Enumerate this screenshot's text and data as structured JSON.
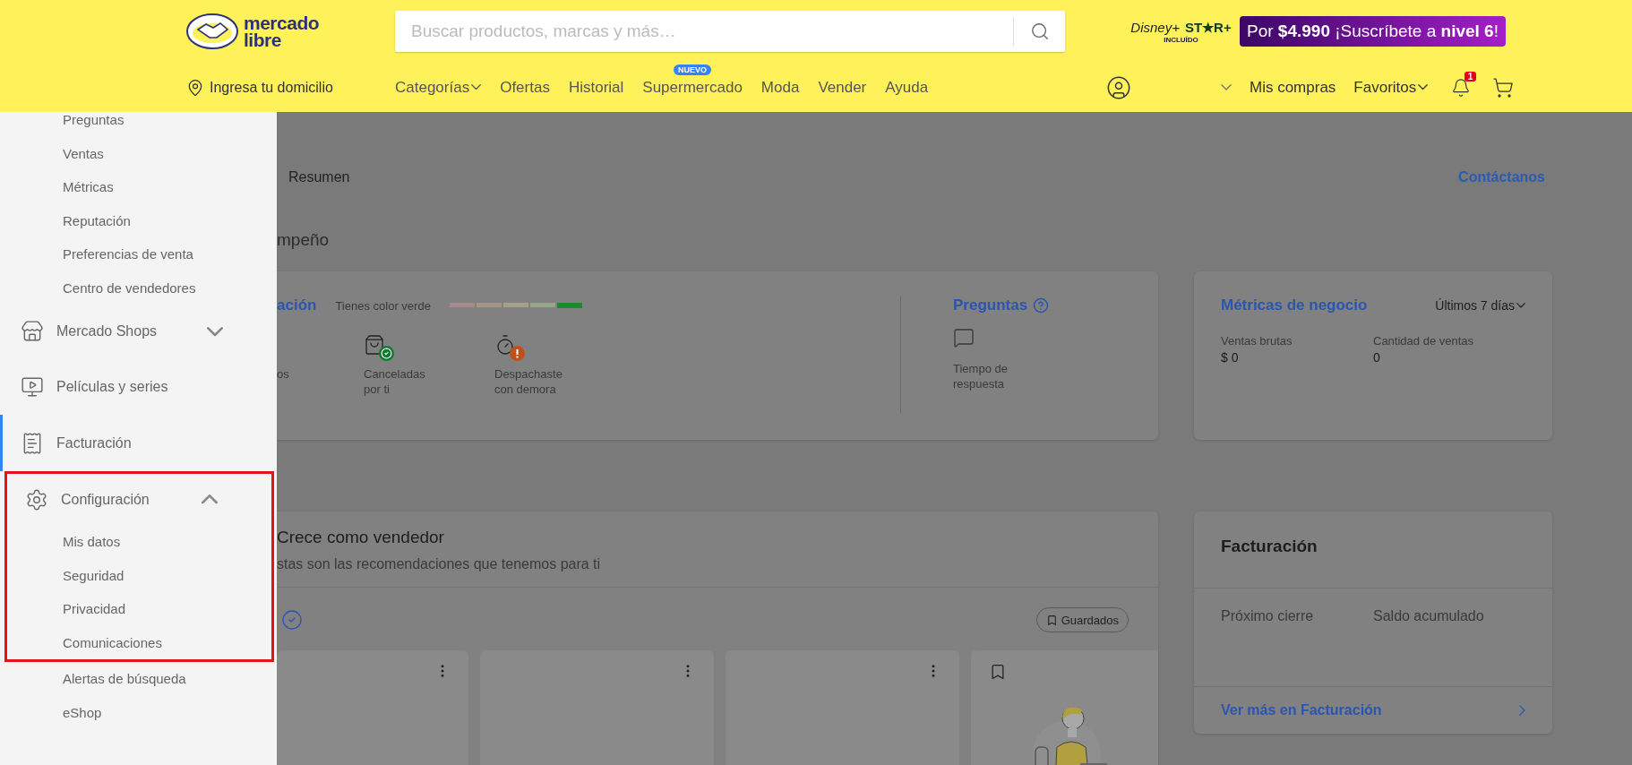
{
  "header": {
    "logo": {
      "line1": "mercado",
      "line2": "libre"
    },
    "search": {
      "placeholder": "Buscar productos, marcas y más…"
    },
    "streaming": {
      "brand1": "Disney+",
      "brand2": "ST★R+",
      "note": "INCLUÍDO"
    },
    "promo": "Por **$4.990** ¡Suscríbete a **nivel 6**!",
    "location": "Ingresa tu domicilio",
    "nav": [
      {
        "label": "Categorías",
        "dropdown": true
      },
      {
        "label": "Ofertas",
        "dropdown": false
      },
      {
        "label": "Historial",
        "dropdown": false
      },
      {
        "label": "Supermercado",
        "dropdown": false,
        "badge": "NUEVO"
      },
      {
        "label": "Moda",
        "dropdown": false
      },
      {
        "label": "Vender",
        "dropdown": false
      },
      {
        "label": "Ayuda",
        "dropdown": false
      }
    ],
    "account": {
      "dropdown": true
    },
    "links": [
      {
        "label": "Mis compras",
        "dropdown": false
      },
      {
        "label": "Favoritos",
        "dropdown": true
      }
    ],
    "notifications": "1"
  },
  "sidebar": {
    "items": [
      {
        "kind": "link",
        "label": "Preguntas"
      },
      {
        "kind": "link",
        "label": "Ventas"
      },
      {
        "kind": "link",
        "label": "Métricas"
      },
      {
        "kind": "link",
        "label": "Reputación"
      },
      {
        "kind": "link",
        "label": "Preferencias de venta"
      },
      {
        "kind": "link",
        "label": "Centro de vendedores"
      },
      {
        "kind": "section",
        "label": "Mercado Shops",
        "expanded": false,
        "selected": false
      },
      {
        "kind": "section",
        "label": "Películas y series",
        "selected": false
      },
      {
        "kind": "section",
        "label": "Facturación",
        "selected": true
      },
      {
        "kind": "section",
        "label": "Configuración",
        "expanded": true,
        "selected": false,
        "highlighted": true,
        "children": [
          {
            "label": "Mis datos"
          },
          {
            "label": "Seguridad"
          },
          {
            "label": "Privacidad"
          },
          {
            "label": "Comunicaciones"
          }
        ]
      },
      {
        "kind": "link",
        "label": "Alertas de búsqueda"
      },
      {
        "kind": "link",
        "label": "eShop"
      }
    ]
  },
  "main": {
    "tab": "Resumen",
    "contact": "Contáctanos",
    "section_title": "mpeño",
    "reputation": {
      "title": "ación",
      "note": "Tienes color verde",
      "scale": [
        {
          "color": "#a48a8a",
          "selected": false
        },
        {
          "color": "#a4978a",
          "selected": false
        },
        {
          "color": "#a4a28a",
          "selected": false
        },
        {
          "color": "#98a48a",
          "selected": false
        },
        {
          "color": "#1f8a2a",
          "selected": true
        }
      ],
      "stats": [
        {
          "label": "os"
        },
        {
          "label": "Canceladas por ti"
        },
        {
          "label": "Despachaste con demora"
        }
      ]
    },
    "questions": {
      "title": "Preguntas",
      "stat": "Tiempo de respuesta"
    },
    "metrics": {
      "title": "Métricas de negocio",
      "period": "Últimos 7 días",
      "values": [
        {
          "label": "Ventas brutas",
          "value": "$ 0"
        },
        {
          "label": "Cantidad de ventas",
          "value": "0"
        }
      ]
    },
    "grow": {
      "title": "Crece como vendedor",
      "subtitle": "stas son las recomendaciones que tenemos para ti",
      "saved": "Guardados",
      "cards": [
        {
          "kind": "menu"
        },
        {
          "kind": "menu"
        },
        {
          "kind": "menu"
        },
        {
          "kind": "saved"
        }
      ]
    },
    "billing": {
      "title": "Facturación",
      "columns": [
        "Próximo cierre",
        "Saldo acumulado"
      ],
      "link": "Ver más en Facturación"
    }
  }
}
